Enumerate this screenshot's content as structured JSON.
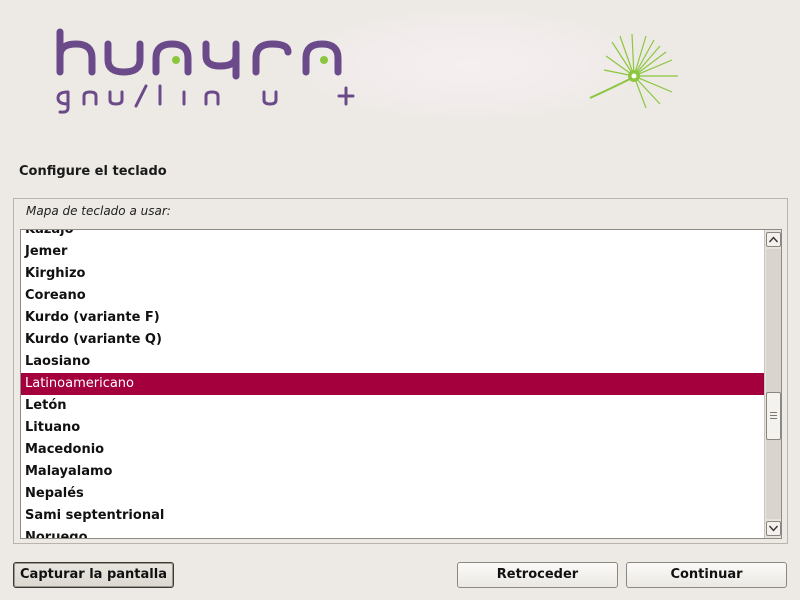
{
  "banner": {
    "logo_name": "huayra",
    "logo_subtitle": "gnu/linux",
    "logo_plus": "+",
    "brand_colors": {
      "purple": "#6b4a8a",
      "green": "#8cc63f"
    }
  },
  "page": {
    "title": "Configure el teclado"
  },
  "keyboard": {
    "label": "Mapa de teclado a usar:",
    "selected": "Latinoamericano",
    "items": [
      "Kazajo",
      "Jemer",
      "Kirghizo",
      "Coreano",
      "Kurdo (variante F)",
      "Kurdo (variante Q)",
      "Laosiano",
      "Latinoamericano",
      "Letón",
      "Lituano",
      "Macedonio",
      "Malayalamo",
      "Nepalés",
      "Sami septentrional",
      "Noruego"
    ],
    "selection_color": "#a5003e"
  },
  "buttons": {
    "screenshot": "Capturar la pantalla",
    "back": "Retroceder",
    "continue": "Continuar"
  },
  "icons": {
    "scroll_up": "arrow-up-icon",
    "scroll_down": "arrow-down-icon",
    "logo_flower": "dandelion-icon"
  }
}
